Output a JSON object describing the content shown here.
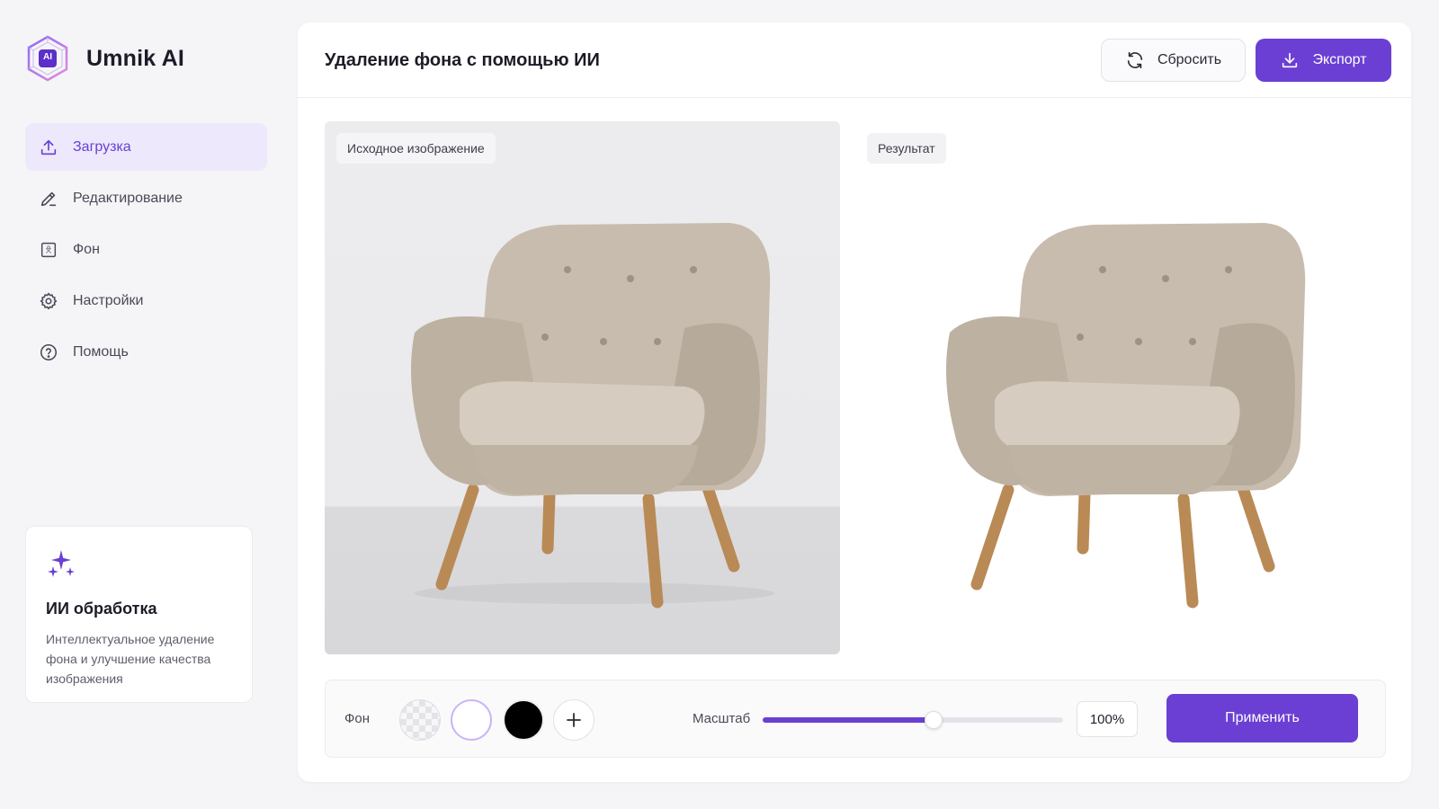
{
  "app": {
    "name": "Umnik AI",
    "logo_badge": "AI"
  },
  "sidebar": {
    "items": [
      {
        "label": "Загрузка",
        "icon": "upload-icon",
        "active": true
      },
      {
        "label": "Редактирование",
        "icon": "pencil-icon",
        "active": false
      },
      {
        "label": "Фон",
        "icon": "background-icon",
        "active": false
      },
      {
        "label": "Настройки",
        "icon": "gear-icon",
        "active": false
      },
      {
        "label": "Помощь",
        "icon": "help-icon",
        "active": false
      }
    ],
    "ai_card": {
      "icon": "sparkles-icon",
      "title": "ИИ обработка",
      "text": "Интеллектуальное удаление фона и улучшение качества изображения"
    }
  },
  "header": {
    "title": "Удаление фона с помощью ИИ",
    "reset_label": "Сбросить",
    "export_label": "Экспорт"
  },
  "panels": {
    "source_label": "Исходное изображение",
    "result_label": "Результат"
  },
  "toolbar": {
    "background_label": "Фон",
    "swatches": [
      "transparent",
      "#ffffff",
      "#000000"
    ],
    "selected_swatch": "#ffffff",
    "scale_label": "Масштаб",
    "scale_value": "100%",
    "scale_fraction": 0.57,
    "apply_label": "Применить"
  },
  "colors": {
    "accent": "#6b3fd3",
    "active_bg": "#ede8fb"
  }
}
